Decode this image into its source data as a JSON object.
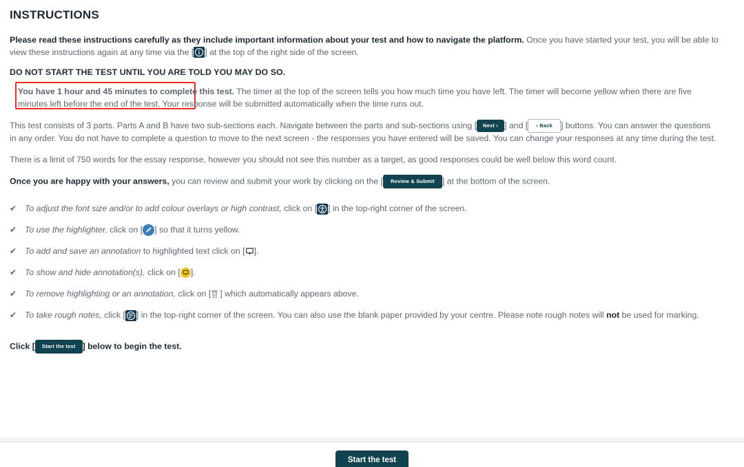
{
  "page": {
    "title": "INSTRUCTIONS"
  },
  "paragraphs": {
    "intro_bold": "Please read these instructions carefully as they include important information about your test and how to navigate the platform.",
    "intro_rest_a": " Once you have started your test, you will be able to view these instructions again at any time via the [",
    "intro_rest_b": "] at the top of the right side of the screen.",
    "do_not_start": "DO NOT START THE TEST UNTIL YOU ARE TOLD YOU MAY DO SO.",
    "timing_bold": "You have 1 hour and 45 minutes to complete this test.",
    "timing_rest": " The timer at the top of the screen tells you how much time you have left. The timer will become yellow when there are five minutes left before the end of the test. Your response will be submitted automatically when the time runs out.",
    "parts_a": "This test consists of 3 parts. Parts A and B have two sub-sections each. Navigate between the parts and sub-sections using [",
    "parts_b": "] and [",
    "parts_c": "] buttons. You can answer the questions in any order. You do not have to complete a question to move to the next screen - the responses you have entered will be saved. You can change your responses at any time during the test.",
    "word_limit": "There is a limit of 750 words for the essay response, however you should not see this number as a target, as good responses could be well below this word count.",
    "happy_bold": "Once you are happy with your answers,",
    "happy_rest_a": " you can review and submit your work by clicking on the [",
    "happy_rest_b": "] at the bottom of the screen."
  },
  "buttons": {
    "next_label": "Next ›",
    "back_label": "‹ Back",
    "review_submit_label": "Review & Submit",
    "start_test_inline_label": "Start the test",
    "start_test_footer_label": "Start the test"
  },
  "checklist": [
    {
      "check": "✔",
      "italic": "To adjust the font size and/or to add colour overlays or high contrast,",
      "before_icon": " click on [",
      "icon": "accessibility-icon",
      "after_icon": "] in the top-right corner of the screen."
    },
    {
      "check": "✔",
      "italic": "To use the highlighter,",
      "before_icon": " click on [",
      "icon": "highlighter-pencil-icon",
      "after_icon": "] so that it turns yellow."
    },
    {
      "check": "✔",
      "italic": "To add and save an annotation",
      "before_icon": " to highlighted text click on [",
      "icon": "annotation-comment-icon",
      "after_icon": "]."
    },
    {
      "check": "✔",
      "italic": "To show and hide annotation(s),",
      "before_icon": " click on [",
      "icon": "annotation-toggle-icon",
      "after_icon": "]."
    },
    {
      "check": "✔",
      "italic": "To remove highlighting or an annotation,",
      "before_icon": " click on [",
      "icon": "trash-icon",
      "after_icon": "] which automatically appears above."
    },
    {
      "check": "✔",
      "italic": "To take rough notes,",
      "before_icon": " click [",
      "icon": "rough-notes-icon",
      "after_icon_1": "] in the top-right corner of the screen. You can also use the blank paper provided by your centre. Please note rough notes will ",
      "bold_word": "not",
      "after_icon_2": " be used for marking."
    }
  ],
  "click_line": {
    "prefix": "Click [",
    "suffix": "] below to begin the test."
  },
  "colors": {
    "brand_dark": "#114350",
    "icon_navy": "#123a55",
    "highlighter_blue": "#3c7fb8",
    "annotation_yellow": "#f5c518",
    "alert_red": "#ee2d24",
    "body_text": "#5c6670",
    "heading_text": "#1b2a33"
  }
}
